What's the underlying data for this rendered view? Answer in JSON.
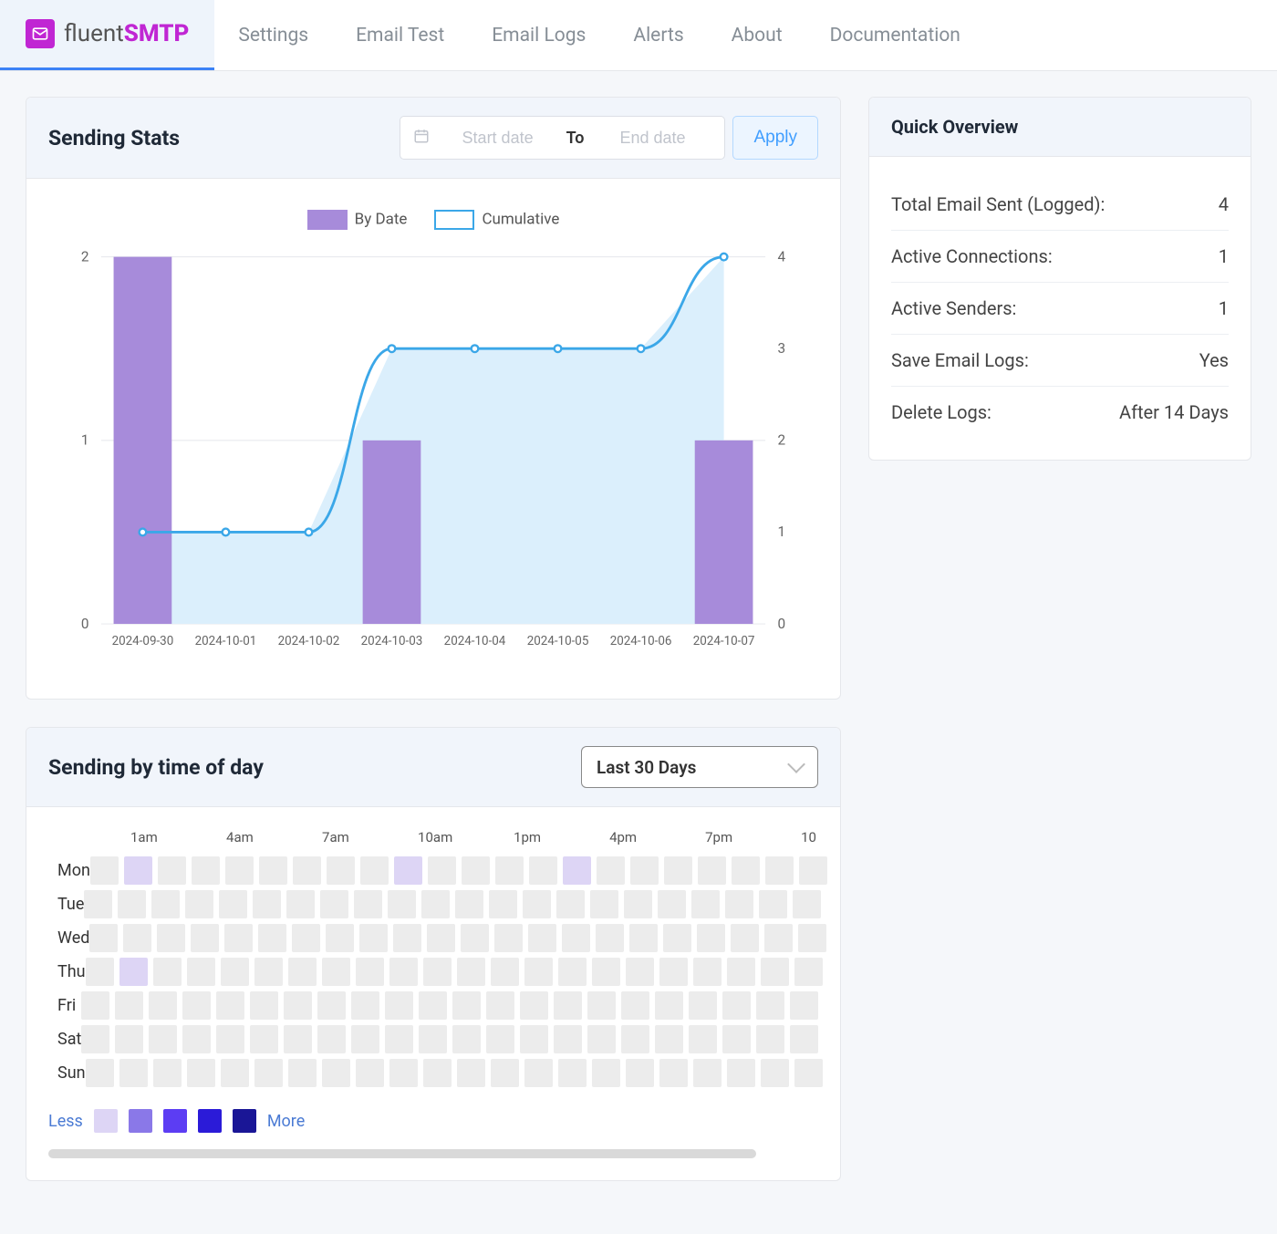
{
  "brand": {
    "fluent": "fluent",
    "smtp": "SMTP"
  },
  "nav": [
    "Settings",
    "Email Test",
    "Email Logs",
    "Alerts",
    "About",
    "Documentation"
  ],
  "sending_stats": {
    "title": "Sending Stats",
    "start_placeholder": "Start date",
    "to_label": "To",
    "end_placeholder": "End date",
    "apply_label": "Apply",
    "legend_bar": "By Date",
    "legend_line": "Cumulative"
  },
  "chart_data": {
    "type": "bar+line",
    "title": "Sending Stats",
    "series": [
      {
        "name": "By Date",
        "type": "bar",
        "axis": "left",
        "values": [
          2,
          0,
          0,
          1,
          0,
          0,
          0,
          1
        ]
      },
      {
        "name": "Cumulative",
        "type": "line",
        "axis": "right",
        "values": [
          1,
          1,
          1,
          3,
          3,
          3,
          3,
          4
        ]
      }
    ],
    "categories": [
      "2024-09-30",
      "2024-10-01",
      "2024-10-02",
      "2024-10-03",
      "2024-10-04",
      "2024-10-05",
      "2024-10-06",
      "2024-10-07"
    ],
    "left_ticks": [
      0,
      1,
      2
    ],
    "right_ticks": [
      0,
      1,
      2,
      3,
      4
    ],
    "left_ylim": [
      0,
      2
    ],
    "right_ylim": [
      0,
      4
    ]
  },
  "overview": {
    "title": "Quick Overview",
    "rows": [
      {
        "label": "Total Email Sent (Logged):",
        "value": "4"
      },
      {
        "label": "Active Connections:",
        "value": "1"
      },
      {
        "label": "Active Senders:",
        "value": "1"
      },
      {
        "label": "Save Email Logs:",
        "value": "Yes"
      },
      {
        "label": "Delete Logs:",
        "value": "After 14 Days"
      }
    ]
  },
  "heatmap": {
    "title": "Sending by time of day",
    "period_selected": "Last 30 Days",
    "hour_labels": [
      "1am",
      "4am",
      "7am",
      "10am",
      "1pm",
      "4pm",
      "7pm"
    ],
    "days": [
      "Mon",
      "Tue",
      "Wed",
      "Thu",
      "Fri",
      "Sat",
      "Sun"
    ],
    "cells": [
      [
        0,
        1,
        0,
        0,
        0,
        0,
        0,
        0,
        0,
        1,
        0,
        0,
        0,
        0,
        1,
        0,
        0,
        0,
        0,
        0,
        0,
        0
      ],
      [
        0,
        0,
        0,
        0,
        0,
        0,
        0,
        0,
        0,
        0,
        0,
        0,
        0,
        0,
        0,
        0,
        0,
        0,
        0,
        0,
        0,
        0
      ],
      [
        0,
        0,
        0,
        0,
        0,
        0,
        0,
        0,
        0,
        0,
        0,
        0,
        0,
        0,
        0,
        0,
        0,
        0,
        0,
        0,
        0,
        0
      ],
      [
        0,
        1,
        0,
        0,
        0,
        0,
        0,
        0,
        0,
        0,
        0,
        0,
        0,
        0,
        0,
        0,
        0,
        0,
        0,
        0,
        0,
        0
      ],
      [
        0,
        0,
        0,
        0,
        0,
        0,
        0,
        0,
        0,
        0,
        0,
        0,
        0,
        0,
        0,
        0,
        0,
        0,
        0,
        0,
        0,
        0
      ],
      [
        0,
        0,
        0,
        0,
        0,
        0,
        0,
        0,
        0,
        0,
        0,
        0,
        0,
        0,
        0,
        0,
        0,
        0,
        0,
        0,
        0,
        0
      ],
      [
        0,
        0,
        0,
        0,
        0,
        0,
        0,
        0,
        0,
        0,
        0,
        0,
        0,
        0,
        0,
        0,
        0,
        0,
        0,
        0,
        0,
        0
      ]
    ],
    "legend_less": "Less",
    "legend_more": "More",
    "hour_tail": "10"
  }
}
